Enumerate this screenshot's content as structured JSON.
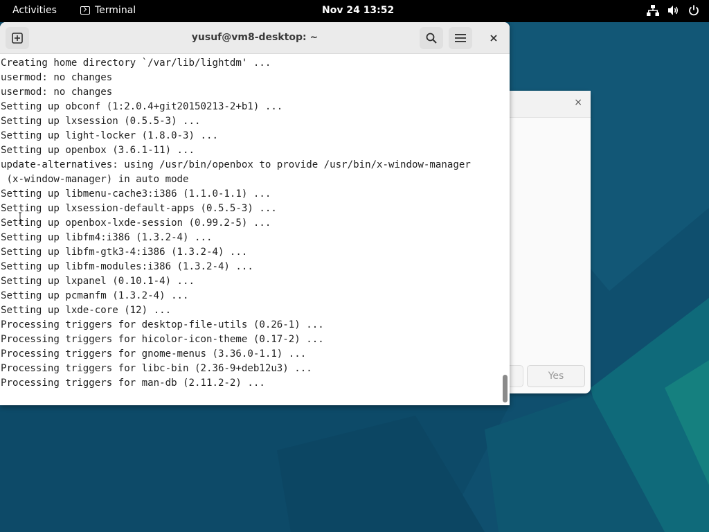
{
  "topbar": {
    "activities": "Activities",
    "app_name": "Terminal",
    "clock": "Nov 24  13:52",
    "tray_icons": [
      "network-icon",
      "volume-icon",
      "power-icon"
    ]
  },
  "terminal": {
    "title": "yusuf@vm8-desktop: ~",
    "lines": [
      "Creating home directory `/var/lib/lightdm' ...",
      "usermod: no changes",
      "usermod: no changes",
      "Setting up obconf (1:2.0.4+git20150213-2+b1) ...",
      "Setting up lxsession (0.5.5-3) ...",
      "Setting up light-locker (1.8.0-3) ...",
      "Setting up openbox (3.6.1-11) ...",
      "update-alternatives: using /usr/bin/openbox to provide /usr/bin/x-window-manager",
      " (x-window-manager) in auto mode",
      "Setting up libmenu-cache3:i386 (1.1.0-1.1) ...",
      "Setting up lxsession-default-apps (0.5.5-3) ...",
      "Setting up openbox-lxde-session (0.99.2-5) ...",
      "Setting up libfm4:i386 (1.3.2-4) ...",
      "Setting up libfm-gtk3-4:i386 (1.3.2-4) ...",
      "Setting up libfm-modules:i386 (1.3.2-4) ...",
      "Setting up lxpanel (0.10.1-4) ...",
      "Setting up pcmanfm (1.3.2-4) ...",
      "Setting up lxde-core (12) ...",
      "Processing triggers for desktop-file-utils (0.26-1) ...",
      "Processing triggers for hicolor-icon-theme (0.17-2) ...",
      "Processing triggers for gnome-menus (3.36.0-1.1) ...",
      "Processing triggers for libc-bin (2.36-9+deb12u3) ...",
      "Processing triggers for man-db (2.11.2-2) ..."
    ]
  },
  "dialog": {
    "yes_label": "Yes",
    "close_glyph": "×"
  },
  "colors": {
    "desktop": "#0f4f6e",
    "topbar": "#000000",
    "headerbar": "#ebebeb"
  }
}
